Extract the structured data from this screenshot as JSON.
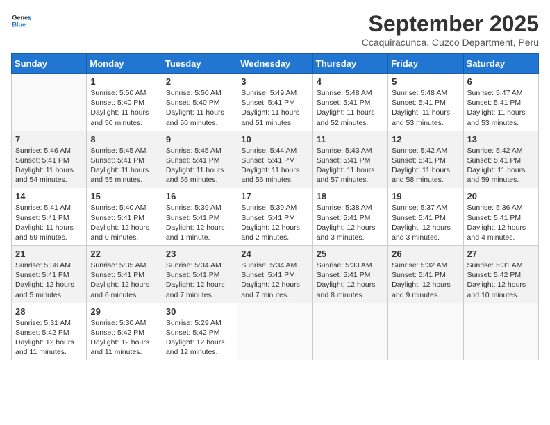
{
  "logo": {
    "general": "General",
    "blue": "Blue"
  },
  "header": {
    "month_year": "September 2025",
    "location": "Ccaquiracunca, Cuzco Department, Peru"
  },
  "weekdays": [
    "Sunday",
    "Monday",
    "Tuesday",
    "Wednesday",
    "Thursday",
    "Friday",
    "Saturday"
  ],
  "weeks": [
    [
      {
        "day": "",
        "info": ""
      },
      {
        "day": "1",
        "info": "Sunrise: 5:50 AM\nSunset: 5:40 PM\nDaylight: 11 hours\nand 50 minutes."
      },
      {
        "day": "2",
        "info": "Sunrise: 5:50 AM\nSunset: 5:40 PM\nDaylight: 11 hours\nand 50 minutes."
      },
      {
        "day": "3",
        "info": "Sunrise: 5:49 AM\nSunset: 5:41 PM\nDaylight: 11 hours\nand 51 minutes."
      },
      {
        "day": "4",
        "info": "Sunrise: 5:48 AM\nSunset: 5:41 PM\nDaylight: 11 hours\nand 52 minutes."
      },
      {
        "day": "5",
        "info": "Sunrise: 5:48 AM\nSunset: 5:41 PM\nDaylight: 11 hours\nand 53 minutes."
      },
      {
        "day": "6",
        "info": "Sunrise: 5:47 AM\nSunset: 5:41 PM\nDaylight: 11 hours\nand 53 minutes."
      }
    ],
    [
      {
        "day": "7",
        "info": "Sunrise: 5:46 AM\nSunset: 5:41 PM\nDaylight: 11 hours\nand 54 minutes."
      },
      {
        "day": "8",
        "info": "Sunrise: 5:45 AM\nSunset: 5:41 PM\nDaylight: 11 hours\nand 55 minutes."
      },
      {
        "day": "9",
        "info": "Sunrise: 5:45 AM\nSunset: 5:41 PM\nDaylight: 11 hours\nand 56 minutes."
      },
      {
        "day": "10",
        "info": "Sunrise: 5:44 AM\nSunset: 5:41 PM\nDaylight: 11 hours\nand 56 minutes."
      },
      {
        "day": "11",
        "info": "Sunrise: 5:43 AM\nSunset: 5:41 PM\nDaylight: 11 hours\nand 57 minutes."
      },
      {
        "day": "12",
        "info": "Sunrise: 5:42 AM\nSunset: 5:41 PM\nDaylight: 11 hours\nand 58 minutes."
      },
      {
        "day": "13",
        "info": "Sunrise: 5:42 AM\nSunset: 5:41 PM\nDaylight: 11 hours\nand 59 minutes."
      }
    ],
    [
      {
        "day": "14",
        "info": "Sunrise: 5:41 AM\nSunset: 5:41 PM\nDaylight: 11 hours\nand 59 minutes."
      },
      {
        "day": "15",
        "info": "Sunrise: 5:40 AM\nSunset: 5:41 PM\nDaylight: 12 hours\nand 0 minutes."
      },
      {
        "day": "16",
        "info": "Sunrise: 5:39 AM\nSunset: 5:41 PM\nDaylight: 12 hours\nand 1 minute."
      },
      {
        "day": "17",
        "info": "Sunrise: 5:39 AM\nSunset: 5:41 PM\nDaylight: 12 hours\nand 2 minutes."
      },
      {
        "day": "18",
        "info": "Sunrise: 5:38 AM\nSunset: 5:41 PM\nDaylight: 12 hours\nand 3 minutes."
      },
      {
        "day": "19",
        "info": "Sunrise: 5:37 AM\nSunset: 5:41 PM\nDaylight: 12 hours\nand 3 minutes."
      },
      {
        "day": "20",
        "info": "Sunrise: 5:36 AM\nSunset: 5:41 PM\nDaylight: 12 hours\nand 4 minutes."
      }
    ],
    [
      {
        "day": "21",
        "info": "Sunrise: 5:36 AM\nSunset: 5:41 PM\nDaylight: 12 hours\nand 5 minutes."
      },
      {
        "day": "22",
        "info": "Sunrise: 5:35 AM\nSunset: 5:41 PM\nDaylight: 12 hours\nand 6 minutes."
      },
      {
        "day": "23",
        "info": "Sunrise: 5:34 AM\nSunset: 5:41 PM\nDaylight: 12 hours\nand 7 minutes."
      },
      {
        "day": "24",
        "info": "Sunrise: 5:34 AM\nSunset: 5:41 PM\nDaylight: 12 hours\nand 7 minutes."
      },
      {
        "day": "25",
        "info": "Sunrise: 5:33 AM\nSunset: 5:41 PM\nDaylight: 12 hours\nand 8 minutes."
      },
      {
        "day": "26",
        "info": "Sunrise: 5:32 AM\nSunset: 5:41 PM\nDaylight: 12 hours\nand 9 minutes."
      },
      {
        "day": "27",
        "info": "Sunrise: 5:31 AM\nSunset: 5:42 PM\nDaylight: 12 hours\nand 10 minutes."
      }
    ],
    [
      {
        "day": "28",
        "info": "Sunrise: 5:31 AM\nSunset: 5:42 PM\nDaylight: 12 hours\nand 11 minutes."
      },
      {
        "day": "29",
        "info": "Sunrise: 5:30 AM\nSunset: 5:42 PM\nDaylight: 12 hours\nand 11 minutes."
      },
      {
        "day": "30",
        "info": "Sunrise: 5:29 AM\nSunset: 5:42 PM\nDaylight: 12 hours\nand 12 minutes."
      },
      {
        "day": "",
        "info": ""
      },
      {
        "day": "",
        "info": ""
      },
      {
        "day": "",
        "info": ""
      },
      {
        "day": "",
        "info": ""
      }
    ]
  ]
}
